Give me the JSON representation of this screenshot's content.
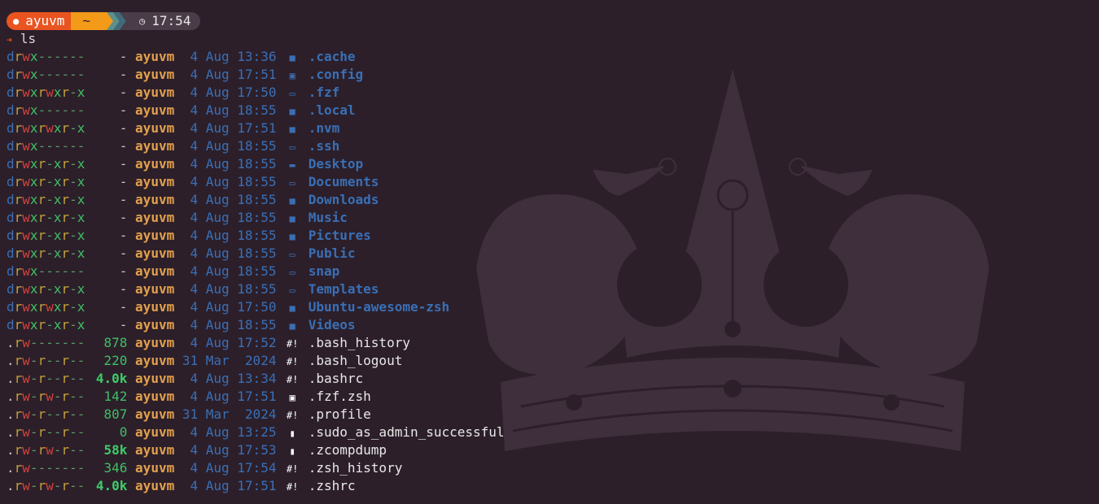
{
  "prompt": {
    "user_icon": "ubuntu-icon",
    "user": "ayuvm",
    "dir": "~",
    "clock_icon": "clock-icon",
    "time": "17:54",
    "colors": {
      "user_bg": "#e95420",
      "dir_bg": "#f39a19",
      "time_bg": "#4a3c48"
    }
  },
  "command": {
    "arrow": "➔",
    "text": "ls"
  },
  "entries": [
    {
      "p": [
        "d",
        "r",
        "w",
        "x",
        "-",
        "-",
        "-",
        "-",
        "-",
        "-"
      ],
      "size": "-",
      "user": "ayuvm",
      "date": " 4 Aug 13:36",
      "icon": "folder-icon",
      "glyph": "■",
      "name": ".cache",
      "kind": "dir"
    },
    {
      "p": [
        "d",
        "r",
        "w",
        "x",
        "-",
        "-",
        "-",
        "-",
        "-",
        "-"
      ],
      "size": "-",
      "user": "ayuvm",
      "date": " 4 Aug 17:51",
      "icon": "folder-config-icon",
      "glyph": "▣",
      "name": ".config",
      "kind": "dir"
    },
    {
      "p": [
        "d",
        "r",
        "w",
        "x",
        "r",
        "w",
        "x",
        "r",
        "-",
        "x"
      ],
      "size": "-",
      "user": "ayuvm",
      "date": " 4 Aug 17:50",
      "icon": "folder-open-icon",
      "glyph": "▭",
      "name": ".fzf",
      "kind": "dir"
    },
    {
      "p": [
        "d",
        "r",
        "w",
        "x",
        "-",
        "-",
        "-",
        "-",
        "-",
        "-"
      ],
      "size": "-",
      "user": "ayuvm",
      "date": " 4 Aug 18:55",
      "icon": "folder-icon",
      "glyph": "■",
      "name": ".local",
      "kind": "dir"
    },
    {
      "p": [
        "d",
        "r",
        "w",
        "x",
        "r",
        "w",
        "x",
        "r",
        "-",
        "x"
      ],
      "size": "-",
      "user": "ayuvm",
      "date": " 4 Aug 17:51",
      "icon": "folder-icon",
      "glyph": "■",
      "name": ".nvm",
      "kind": "dir"
    },
    {
      "p": [
        "d",
        "r",
        "w",
        "x",
        "-",
        "-",
        "-",
        "-",
        "-",
        "-"
      ],
      "size": "-",
      "user": "ayuvm",
      "date": " 4 Aug 18:55",
      "icon": "folder-ssh-icon",
      "glyph": "▭",
      "name": ".ssh",
      "kind": "dir"
    },
    {
      "p": [
        "d",
        "r",
        "w",
        "x",
        "r",
        "-",
        "x",
        "r",
        "-",
        "x"
      ],
      "size": "-",
      "user": "ayuvm",
      "date": " 4 Aug 18:55",
      "icon": "desktop-icon",
      "glyph": "▬",
      "name": "Desktop",
      "kind": "dir"
    },
    {
      "p": [
        "d",
        "r",
        "w",
        "x",
        "r",
        "-",
        "x",
        "r",
        "-",
        "x"
      ],
      "size": "-",
      "user": "ayuvm",
      "date": " 4 Aug 18:55",
      "icon": "folder-open-icon",
      "glyph": "▭",
      "name": "Documents",
      "kind": "dir"
    },
    {
      "p": [
        "d",
        "r",
        "w",
        "x",
        "r",
        "-",
        "x",
        "r",
        "-",
        "x"
      ],
      "size": "-",
      "user": "ayuvm",
      "date": " 4 Aug 18:55",
      "icon": "folder-icon",
      "glyph": "■",
      "name": "Downloads",
      "kind": "dir"
    },
    {
      "p": [
        "d",
        "r",
        "w",
        "x",
        "r",
        "-",
        "x",
        "r",
        "-",
        "x"
      ],
      "size": "-",
      "user": "ayuvm",
      "date": " 4 Aug 18:55",
      "icon": "folder-icon",
      "glyph": "■",
      "name": "Music",
      "kind": "dir"
    },
    {
      "p": [
        "d",
        "r",
        "w",
        "x",
        "r",
        "-",
        "x",
        "r",
        "-",
        "x"
      ],
      "size": "-",
      "user": "ayuvm",
      "date": " 4 Aug 18:55",
      "icon": "folder-icon",
      "glyph": "■",
      "name": "Pictures",
      "kind": "dir"
    },
    {
      "p": [
        "d",
        "r",
        "w",
        "x",
        "r",
        "-",
        "x",
        "r",
        "-",
        "x"
      ],
      "size": "-",
      "user": "ayuvm",
      "date": " 4 Aug 18:55",
      "icon": "folder-open-icon",
      "glyph": "▭",
      "name": "Public",
      "kind": "dir"
    },
    {
      "p": [
        "d",
        "r",
        "w",
        "x",
        "-",
        "-",
        "-",
        "-",
        "-",
        "-"
      ],
      "size": "-",
      "user": "ayuvm",
      "date": " 4 Aug 18:55",
      "icon": "folder-open-icon",
      "glyph": "▭",
      "name": "snap",
      "kind": "dir"
    },
    {
      "p": [
        "d",
        "r",
        "w",
        "x",
        "r",
        "-",
        "x",
        "r",
        "-",
        "x"
      ],
      "size": "-",
      "user": "ayuvm",
      "date": " 4 Aug 18:55",
      "icon": "folder-open-icon",
      "glyph": "▭",
      "name": "Templates",
      "kind": "dir"
    },
    {
      "p": [
        "d",
        "r",
        "w",
        "x",
        "r",
        "w",
        "x",
        "r",
        "-",
        "x"
      ],
      "size": "-",
      "user": "ayuvm",
      "date": " 4 Aug 17:50",
      "icon": "folder-icon",
      "glyph": "■",
      "name": "Ubuntu-awesome-zsh",
      "kind": "dir"
    },
    {
      "p": [
        "d",
        "r",
        "w",
        "x",
        "r",
        "-",
        "x",
        "r",
        "-",
        "x"
      ],
      "size": "-",
      "user": "ayuvm",
      "date": " 4 Aug 18:55",
      "icon": "video-folder-icon",
      "glyph": "■",
      "name": "Videos",
      "kind": "dir"
    },
    {
      "p": [
        ".",
        "r",
        "w",
        "-",
        "-",
        "-",
        "-",
        "-",
        "-",
        "-"
      ],
      "size": "878",
      "user": "ayuvm",
      "date": " 4 Aug 17:52",
      "icon": "shell-script-icon",
      "glyph": "#!",
      "name": ".bash_history",
      "kind": "file"
    },
    {
      "p": [
        ".",
        "r",
        "w",
        "-",
        "r",
        "-",
        "-",
        "r",
        "-",
        "-"
      ],
      "size": "220",
      "user": "ayuvm",
      "date": "31 Mar  2024",
      "icon": "shell-script-icon",
      "glyph": "#!",
      "name": ".bash_logout",
      "kind": "file"
    },
    {
      "p": [
        ".",
        "r",
        "w",
        "-",
        "r",
        "-",
        "-",
        "r",
        "-",
        "-"
      ],
      "size": "4.0k",
      "user": "ayuvm",
      "date": " 4 Aug 13:34",
      "icon": "shell-script-icon",
      "glyph": "#!",
      "name": ".bashrc",
      "kind": "file"
    },
    {
      "p": [
        ".",
        "r",
        "w",
        "-",
        "r",
        "w",
        "-",
        "r",
        "-",
        "-"
      ],
      "size": "142",
      "user": "ayuvm",
      "date": " 4 Aug 17:51",
      "icon": "terminal-icon",
      "glyph": "▣",
      "name": ".fzf.zsh",
      "kind": "file"
    },
    {
      "p": [
        ".",
        "r",
        "w",
        "-",
        "r",
        "-",
        "-",
        "r",
        "-",
        "-"
      ],
      "size": "807",
      "user": "ayuvm",
      "date": "31 Mar  2024",
      "icon": "shell-script-icon",
      "glyph": "#!",
      "name": ".profile",
      "kind": "file"
    },
    {
      "p": [
        ".",
        "r",
        "w",
        "-",
        "r",
        "-",
        "-",
        "r",
        "-",
        "-"
      ],
      "size": "0",
      "user": "ayuvm",
      "date": " 4 Aug 13:25",
      "icon": "file-icon",
      "glyph": "▮",
      "name": ".sudo_as_admin_successful",
      "kind": "file"
    },
    {
      "p": [
        ".",
        "r",
        "w",
        "-",
        "r",
        "w",
        "-",
        "r",
        "-",
        "-"
      ],
      "size": "58k",
      "user": "ayuvm",
      "date": " 4 Aug 17:53",
      "icon": "file-icon",
      "glyph": "▮",
      "name": ".zcompdump",
      "kind": "file"
    },
    {
      "p": [
        ".",
        "r",
        "w",
        "-",
        "-",
        "-",
        "-",
        "-",
        "-",
        "-"
      ],
      "size": "346",
      "user": "ayuvm",
      "date": " 4 Aug 17:54",
      "icon": "shell-script-icon",
      "glyph": "#!",
      "name": ".zsh_history",
      "kind": "file"
    },
    {
      "p": [
        ".",
        "r",
        "w",
        "-",
        "r",
        "w",
        "-",
        "r",
        "-",
        "-"
      ],
      "size": "4.0k",
      "user": "ayuvm",
      "date": " 4 Aug 17:51",
      "icon": "shell-script-icon",
      "glyph": "#!",
      "name": ".zshrc",
      "kind": "file"
    }
  ]
}
